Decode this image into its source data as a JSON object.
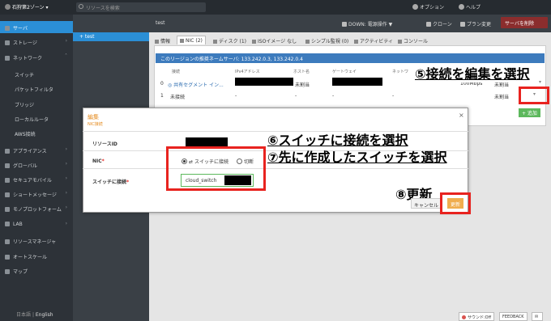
{
  "topbar": {
    "zone": "石狩第2ゾーン",
    "search_placeholder": "リソースを検索",
    "options": "オプション",
    "help": "ヘルプ"
  },
  "sidebar": {
    "items": [
      {
        "label": "サーバ",
        "icon": "server-icon"
      },
      {
        "label": "ストレージ",
        "icon": "storage-icon"
      },
      {
        "label": "ネットワーク",
        "icon": "network-icon"
      },
      {
        "label": "スイッチ"
      },
      {
        "label": "パケットフィルタ"
      },
      {
        "label": "ブリッジ"
      },
      {
        "label": "ローカルルータ"
      },
      {
        "label": "AWS接続"
      },
      {
        "label": "アプライアンス",
        "icon": "appliance-icon"
      },
      {
        "label": "グローバル",
        "icon": "globe-icon"
      },
      {
        "label": "セキュアモバイル",
        "icon": "mobile-icon"
      },
      {
        "label": "ショートメッセージ",
        "icon": "sms-icon"
      },
      {
        "label": "モノプロットフォーム",
        "icon": "iot-icon"
      },
      {
        "label": "LAB",
        "icon": "lab-icon"
      },
      {
        "label": "リソースマネージャ",
        "icon": "resource-manager-icon"
      },
      {
        "label": "オートスケール",
        "icon": "autoscale-icon"
      },
      {
        "label": "マップ",
        "icon": "map-icon"
      }
    ],
    "lang_ja": "日本語",
    "lang_sep": "|",
    "lang_en": "English"
  },
  "tree": {
    "item": "+ test"
  },
  "header": {
    "title": "test",
    "status": "DOWN: 電源操作 ▼",
    "clone": "クローン",
    "plan": "プラン変更",
    "delete": "サーバを削除"
  },
  "tabs": [
    "情報",
    "NIC (2)",
    "ディスク (1)",
    "ISOイメージ なし",
    "シンプル監視 (0)",
    "アクティビティ",
    "コンソール"
  ],
  "nic": {
    "notice": "このリージョンの推奨ネームサーバ: 133.242.0.3, 133.242.0.4",
    "headers": [
      "接続",
      "IPv4アドレス",
      "ホスト名",
      "ゲートウェイ",
      "ネットワ"
    ],
    "row1": {
      "index": "0",
      "connection": "共有セグメント イン...",
      "host": "未割当",
      "bandwidth": "100Mbps",
      "status": "未割当"
    },
    "row2": {
      "index": "1",
      "connection": "未接続",
      "c2": "-",
      "c3": "-",
      "c4": "-",
      "c5": "-",
      "status": "未割当"
    },
    "add": "+ 追加"
  },
  "modal": {
    "title": "編集",
    "subtitle": "NIC接続",
    "close": "×",
    "resource_id_label": "リソースID",
    "nic_label": "NIC",
    "required": "*",
    "radio_switch": "スイッチに接続",
    "radio_disconnect": "切断",
    "switch_label": "スイッチに接続",
    "switch_value": "cloud_switch",
    "cancel": "キャンセル",
    "update": "更新"
  },
  "annotations": {
    "step5": "⑤接続を編集を選択",
    "step6": "⑥スイッチに接続を選択",
    "step7": "⑦先に作成したスイッチを選択",
    "step8": "⑧更新"
  },
  "footer": {
    "sound": "サウンド:Off",
    "feedback": "FEEDBACK"
  },
  "colors": {
    "accent": "#2b8fd6",
    "annotation_red": "#e8231f",
    "modal_orange": "#e58b1e",
    "success": "#5cb85c"
  }
}
